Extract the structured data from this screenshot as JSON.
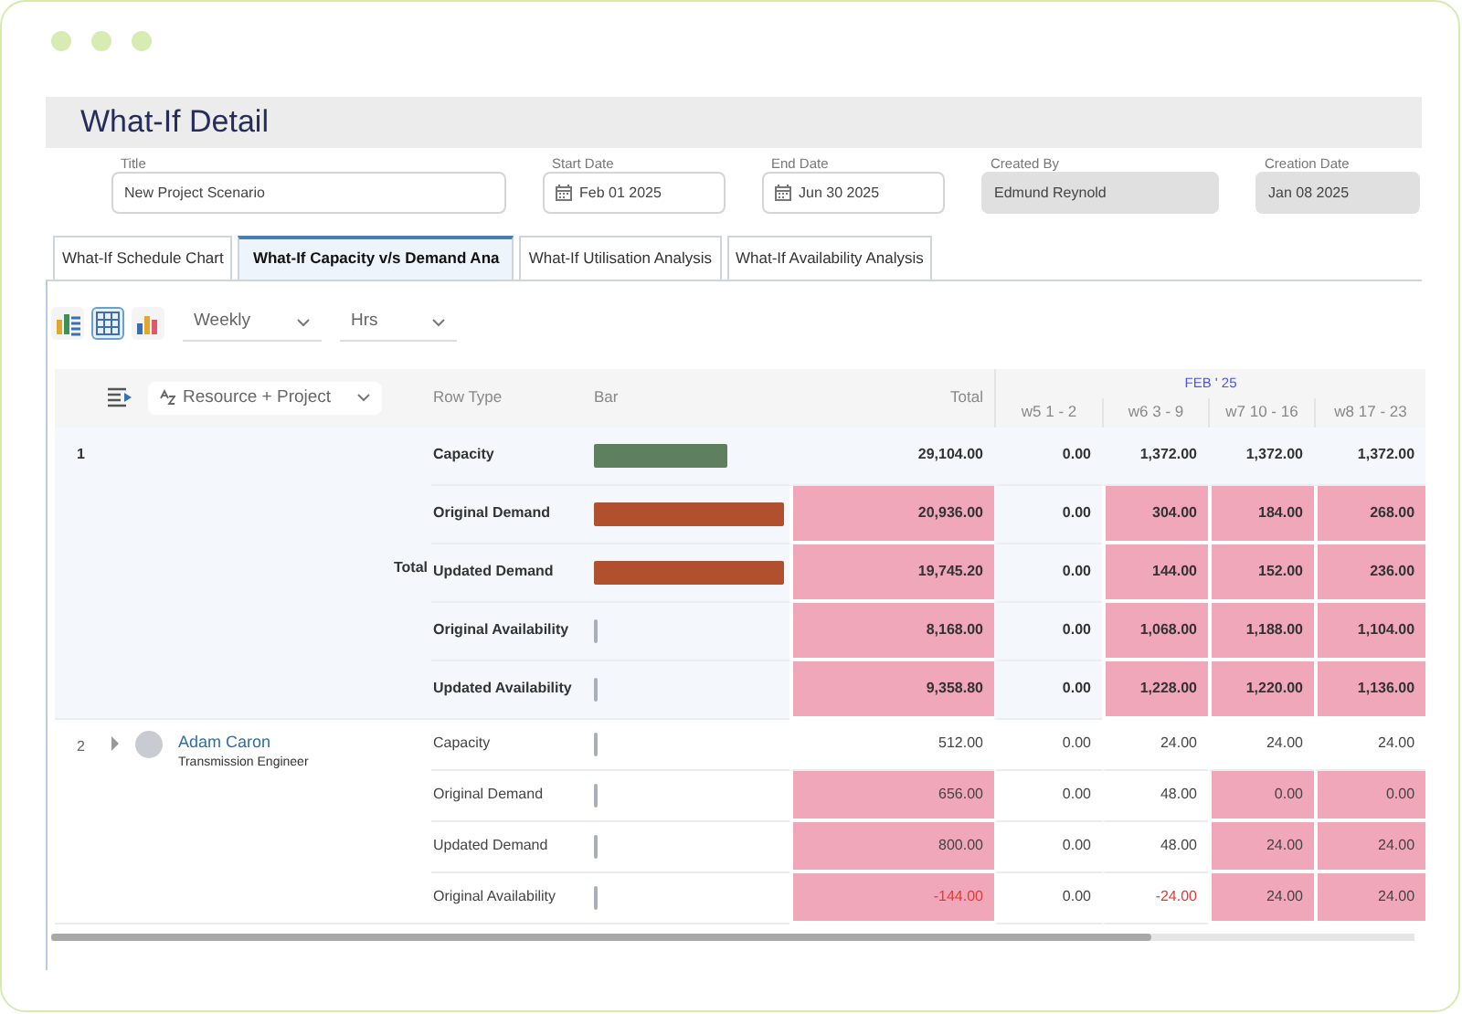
{
  "window": {
    "title": "What-If Detail"
  },
  "fields": [
    {
      "label": "Title",
      "value": "New Project Scenario",
      "kind": "text",
      "disabled": false
    },
    {
      "label": "Start Date",
      "value": "Feb 01 2025",
      "kind": "date",
      "disabled": false
    },
    {
      "label": "End Date",
      "value": "Jun 30 2025",
      "kind": "date",
      "disabled": false
    },
    {
      "label": "Created By",
      "value": "Edmund Reynold",
      "kind": "text",
      "disabled": true
    },
    {
      "label": "Creation Date",
      "value": "Jan 08 2025",
      "kind": "text",
      "disabled": true
    }
  ],
  "tabs": [
    {
      "label": "What-If Schedule Chart",
      "selected": false
    },
    {
      "label": "What-If Capacity v/s Demand Ana",
      "selected": true
    },
    {
      "label": "What-If Utilisation Analysis",
      "selected": false
    },
    {
      "label": "What-If Availability Analysis",
      "selected": false
    }
  ],
  "toolbar": {
    "views": [
      {
        "kind": "stacked",
        "selected": false
      },
      {
        "kind": "grid",
        "selected": true
      },
      {
        "kind": "bars",
        "selected": false
      }
    ],
    "period": "Weekly",
    "unit": "Hrs"
  },
  "grid": {
    "grouping": "Resource + Project",
    "columns": {
      "row_type": "Row Type",
      "bar": "Bar",
      "total": "Total",
      "month": "FEB ' 25",
      "weeks": [
        "w5 1 - 2",
        "w6 3 - 9",
        "w7 10 - 16",
        "w8 17 - 23"
      ]
    },
    "groups": [
      {
        "index": "1",
        "kind": "total",
        "label": "Total",
        "lines": [
          {
            "type": "Capacity",
            "kind": "capacity",
            "level": 0.7,
            "cells": [
              {
                "value": "29,104.00",
                "highlighted": false,
                "negative": false
              },
              {
                "value": "0.00",
                "highlighted": false,
                "negative": false
              },
              {
                "value": "1,372.00",
                "highlighted": false,
                "negative": false
              },
              {
                "value": "1,372.00",
                "highlighted": false,
                "negative": false
              },
              {
                "value": "1,372.00",
                "highlighted": false,
                "negative": false
              }
            ]
          },
          {
            "type": "Original Demand",
            "kind": "demand",
            "level": 1,
            "cells": [
              {
                "value": "20,936.00",
                "highlighted": true,
                "negative": false
              },
              {
                "value": "0.00",
                "highlighted": false,
                "negative": false
              },
              {
                "value": "304.00",
                "highlighted": true,
                "negative": false
              },
              {
                "value": "184.00",
                "highlighted": true,
                "negative": false
              },
              {
                "value": "268.00",
                "highlighted": true,
                "negative": false
              }
            ]
          },
          {
            "type": "Updated Demand",
            "kind": "demand",
            "level": 1,
            "cells": [
              {
                "value": "19,745.20",
                "highlighted": true,
                "negative": false
              },
              {
                "value": "0.00",
                "highlighted": false,
                "negative": false
              },
              {
                "value": "144.00",
                "highlighted": true,
                "negative": false
              },
              {
                "value": "152.00",
                "highlighted": true,
                "negative": false
              },
              {
                "value": "236.00",
                "highlighted": true,
                "negative": false
              }
            ]
          },
          {
            "type": "Original Availability",
            "kind": "availability",
            "level": 0.02,
            "cells": [
              {
                "value": "8,168.00",
                "highlighted": true,
                "negative": false
              },
              {
                "value": "0.00",
                "highlighted": false,
                "negative": false
              },
              {
                "value": "1,068.00",
                "highlighted": true,
                "negative": false
              },
              {
                "value": "1,188.00",
                "highlighted": true,
                "negative": false
              },
              {
                "value": "1,104.00",
                "highlighted": true,
                "negative": false
              }
            ]
          },
          {
            "type": "Updated Availability",
            "kind": "availability",
            "level": 0.02,
            "cells": [
              {
                "value": "9,358.80",
                "highlighted": true,
                "negative": false
              },
              {
                "value": "0.00",
                "highlighted": false,
                "negative": false
              },
              {
                "value": "1,228.00",
                "highlighted": true,
                "negative": false
              },
              {
                "value": "1,220.00",
                "highlighted": true,
                "negative": false
              },
              {
                "value": "1,136.00",
                "highlighted": true,
                "negative": false
              }
            ]
          }
        ]
      },
      {
        "index": "2",
        "kind": "resource",
        "name": "Adam Caron",
        "role": "Transmission Engineer",
        "expanded": false,
        "lines": [
          {
            "type": "Capacity",
            "kind": "availability",
            "level": 0.02,
            "cells": [
              {
                "value": "512.00",
                "highlighted": false,
                "negative": false
              },
              {
                "value": "0.00",
                "highlighted": false,
                "negative": false
              },
              {
                "value": "24.00",
                "highlighted": false,
                "negative": false
              },
              {
                "value": "24.00",
                "highlighted": false,
                "negative": false
              },
              {
                "value": "24.00",
                "highlighted": false,
                "negative": false
              }
            ]
          },
          {
            "type": "Original Demand",
            "kind": "availability",
            "level": 0.02,
            "cells": [
              {
                "value": "656.00",
                "highlighted": true,
                "negative": false
              },
              {
                "value": "0.00",
                "highlighted": false,
                "negative": false
              },
              {
                "value": "48.00",
                "highlighted": false,
                "negative": false
              },
              {
                "value": "0.00",
                "highlighted": true,
                "negative": false
              },
              {
                "value": "0.00",
                "highlighted": true,
                "negative": false
              }
            ]
          },
          {
            "type": "Updated Demand",
            "kind": "availability",
            "level": 0.02,
            "cells": [
              {
                "value": "800.00",
                "highlighted": true,
                "negative": false
              },
              {
                "value": "0.00",
                "highlighted": false,
                "negative": false
              },
              {
                "value": "48.00",
                "highlighted": false,
                "negative": false
              },
              {
                "value": "24.00",
                "highlighted": true,
                "negative": false
              },
              {
                "value": "24.00",
                "highlighted": true,
                "negative": false
              }
            ]
          },
          {
            "type": "Original Availability",
            "kind": "availability",
            "level": 0.02,
            "cells": [
              {
                "value": "-144.00",
                "highlighted": true,
                "negative": true
              },
              {
                "value": "0.00",
                "highlighted": false,
                "negative": false
              },
              {
                "value": "-24.00",
                "highlighted": false,
                "negative": true
              },
              {
                "value": "24.00",
                "highlighted": true,
                "negative": false
              },
              {
                "value": "24.00",
                "highlighted": true,
                "negative": false
              }
            ]
          }
        ]
      }
    ]
  }
}
